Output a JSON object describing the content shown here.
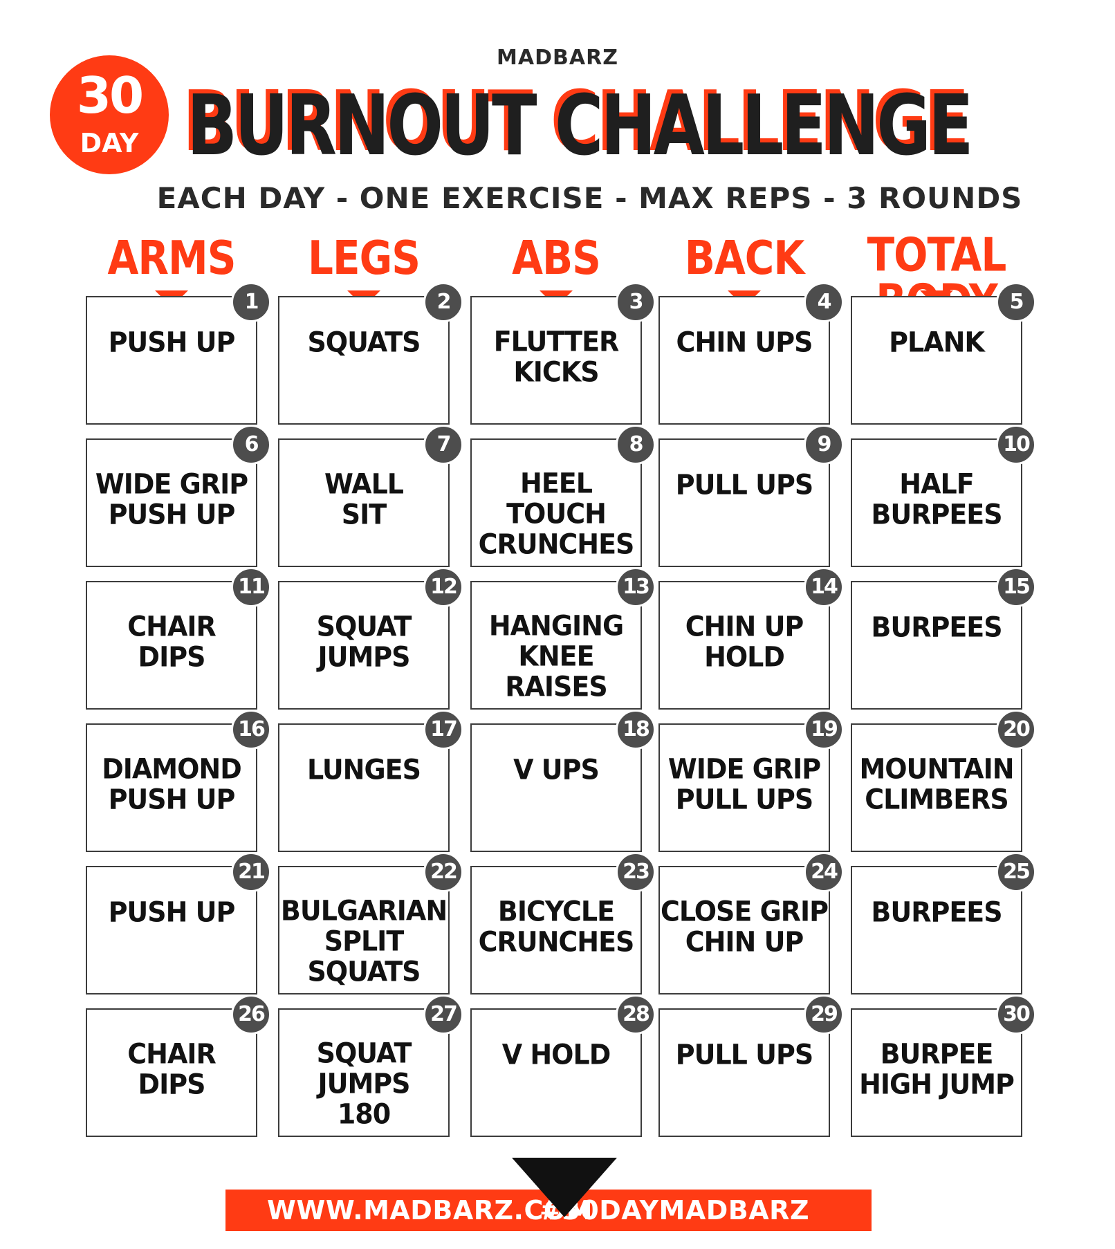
{
  "header": {
    "brand": "MADBARZ",
    "badge_number": "30",
    "badge_label": "DAY",
    "title": "BURNOUT CHALLENGE",
    "subtitle": "EACH DAY - ONE EXERCISE - MAX REPS - 3 ROUNDS"
  },
  "columns": [
    "ARMS",
    "LEGS",
    "ABS",
    "BACK",
    "TOTAL BODY"
  ],
  "days": [
    {
      "n": "1",
      "lines": [
        "PUSH UP"
      ]
    },
    {
      "n": "2",
      "lines": [
        "SQUATS"
      ]
    },
    {
      "n": "3",
      "lines": [
        "FLUTTER",
        "KICKS"
      ]
    },
    {
      "n": "4",
      "lines": [
        "CHIN UPS"
      ]
    },
    {
      "n": "5",
      "lines": [
        "PLANK"
      ]
    },
    {
      "n": "6",
      "lines": [
        "WIDE GRIP",
        "PUSH UP"
      ]
    },
    {
      "n": "7",
      "lines": [
        "WALL",
        "SIT"
      ]
    },
    {
      "n": "8",
      "lines": [
        "HEEL TOUCH",
        "CRUNCHES"
      ]
    },
    {
      "n": "9",
      "lines": [
        "PULL UPS"
      ]
    },
    {
      "n": "10",
      "lines": [
        "HALF",
        "BURPEES"
      ]
    },
    {
      "n": "11",
      "lines": [
        "CHAIR",
        "DIPS"
      ]
    },
    {
      "n": "12",
      "lines": [
        "SQUAT",
        "JUMPS"
      ]
    },
    {
      "n": "13",
      "lines": [
        "HANGING",
        "KNEE",
        "RAISES"
      ]
    },
    {
      "n": "14",
      "lines": [
        "CHIN UP",
        "HOLD"
      ]
    },
    {
      "n": "15",
      "lines": [
        "BURPEES"
      ]
    },
    {
      "n": "16",
      "lines": [
        "DIAMOND",
        "PUSH UP"
      ]
    },
    {
      "n": "17",
      "lines": [
        "LUNGES"
      ]
    },
    {
      "n": "18",
      "lines": [
        "V UPS"
      ]
    },
    {
      "n": "19",
      "lines": [
        "WIDE GRIP",
        "PULL UPS"
      ]
    },
    {
      "n": "20",
      "lines": [
        "MOUNTAIN",
        "CLIMBERS"
      ]
    },
    {
      "n": "21",
      "lines": [
        "PUSH UP"
      ]
    },
    {
      "n": "22",
      "lines": [
        "BULGARIAN",
        "SPLIT",
        "SQUATS"
      ]
    },
    {
      "n": "23",
      "lines": [
        "BICYCLE",
        "CRUNCHES"
      ]
    },
    {
      "n": "24",
      "lines": [
        "CLOSE GRIP",
        "CHIN UP"
      ]
    },
    {
      "n": "25",
      "lines": [
        "BURPEES"
      ]
    },
    {
      "n": "26",
      "lines": [
        "CHAIR",
        "DIPS"
      ]
    },
    {
      "n": "27",
      "lines": [
        "SQUAT",
        "JUMPS",
        "180"
      ]
    },
    {
      "n": "28",
      "lines": [
        "V HOLD"
      ]
    },
    {
      "n": "29",
      "lines": [
        "PULL UPS"
      ]
    },
    {
      "n": "30",
      "lines": [
        "BURPEE",
        "HIGH JUMP"
      ]
    }
  ],
  "footer": {
    "website": "WWW.MADBARZ.COM",
    "hashtag": "#30DAYMADBARZ"
  },
  "colors": {
    "accent": "#ff3b14",
    "dark": "#1f1f1f",
    "badge_gray": "#4d4d4d"
  }
}
